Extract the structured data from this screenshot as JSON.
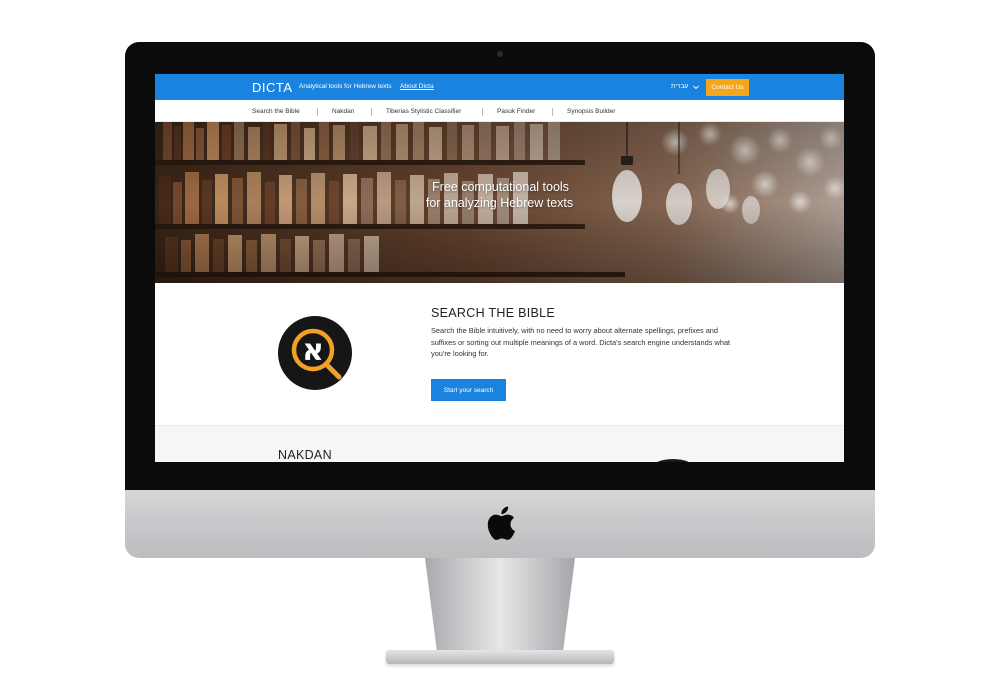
{
  "site": {
    "brand": "DICTA",
    "tagline": "Analytical tools for Hebrew texts",
    "about_link": "About Dicta",
    "language": "עברית",
    "contact_button": "Contact Us"
  },
  "nav": {
    "items": [
      {
        "label": "Search the Bible"
      },
      {
        "label": "Nakdan"
      },
      {
        "label": "Tiberias Stylistic Classifier"
      },
      {
        "label": "Pasuk Finder"
      },
      {
        "label": "Synopsis Builder"
      }
    ]
  },
  "hero": {
    "line1": "Free computational tools",
    "line2": "for analyzing Hebrew texts"
  },
  "bible_section": {
    "title": "SEARCH THE BIBLE",
    "description": "Search the Bible intuitively, with no need to worry about alternate spellings, prefixes and suffixes or sorting out multiple meanings of a word. Dicta's search engine understands what you're looking for.",
    "button": "Start your search",
    "logo_glyph": "א"
  },
  "nakdan_section": {
    "title": "NAKDAN"
  },
  "colors": {
    "brand_blue": "#1a83df",
    "contact_orange": "#f6a61c",
    "logo_orange": "#f2a126"
  },
  "icons": {
    "apple": "apple-logo-icon",
    "chevron": "chevron-down-icon",
    "search_logo": "magnifier-aleph-icon"
  }
}
